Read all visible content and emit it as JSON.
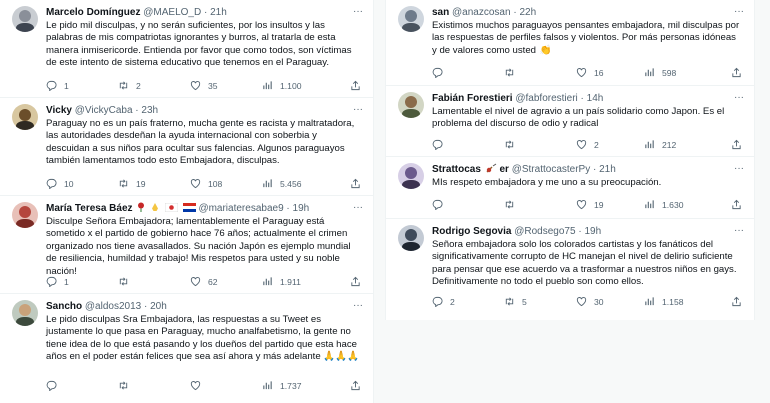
{
  "left_column": [
    {
      "name": "Marcelo Domínguez",
      "handle": "@MAELO_D",
      "time": "21h",
      "text": "Le pido mil disculpas, y no serán suficientes, por los insultos y las palabras de mis compatriotas ignorantes y burros, al tratarla de esta manera inmisericorde. Entienda por favor que como todos, son víctimas de este intento de sistema educativo que tenemos en el Paraguay.",
      "replies": "1",
      "retweets": "2",
      "likes": "35",
      "views": "1.100",
      "avatar_color": "#8a8f99"
    },
    {
      "name": "Vicky",
      "handle": "@VickyCaba",
      "time": "23h",
      "text": "Paraguay no es un país fraterno, mucha gente es racista y maltratadora, las autoridades desdeñan la ayuda internacional con soberbia y descuidan a sus niños para ocultar sus falencias.  Algunos paraguayos también lamentamos todo esto Embajadora, disculpas.",
      "replies": "10",
      "retweets": "19",
      "likes": "108",
      "views": "5.456",
      "avatar_color": "#5b4a2e"
    },
    {
      "name": "María Teresa Báez",
      "handle": "@mariateresabae9",
      "time": "19h",
      "text": "Disculpe Señora Embajadora; lamentablemente el Paraguay está sometido x el partido de gobierno hace 76 años; actualmente el crimen organizado nos tiene avasallados. Su nación Japón es ejemplo mundial de resiliencia, humildad y trabajo! Mis respetos para usted y su noble nación!",
      "replies": "1",
      "retweets": "",
      "likes": "62",
      "views": "1.911",
      "avatar_color": "#b5463d"
    },
    {
      "name": "Sancho",
      "handle": "@aldos2013",
      "time": "20h",
      "text": "Le pido disculpas Sra Embajadora, las respuestas a su Tweet es justamente lo que pasa en Paraguay, mucho analfabetismo, la gente no tiene idea de lo que está pasando y los dueños del partido que esta hace años en el poder están felices que sea así ahora y más adelante",
      "replies": "",
      "retweets": "",
      "likes": "",
      "views": "1.737",
      "avatar_color": "#7a8c7a"
    }
  ],
  "right_column": [
    {
      "name": "san",
      "handle": "@anazcosan",
      "time": "22h",
      "text": "Existimos muchos paraguayos pensantes embajadora, mil disculpas por las respuestas de perfiles falsos y violentos. Por más personas idóneas y de valores como usted",
      "replies": "",
      "retweets": "",
      "likes": "16",
      "views": "598",
      "avatar_color": "#6e7b8b"
    },
    {
      "name": "Fabián Forestieri",
      "handle": "@fabforestieri",
      "time": "14h",
      "text": "Lamentable el nivel de agravio a un país solidario como Japon. Es el problema del discurso de odio y radical",
      "replies": "",
      "retweets": "",
      "likes": "2",
      "views": "212",
      "avatar_color": "#4d5a3c"
    },
    {
      "name": "Strattocas",
      "name_suffix": "er",
      "handle": "@StrattocasterPy",
      "time": "21h",
      "text": "MIs respeto embajadora y me uno a su preocupación.",
      "replies": "",
      "retweets": "",
      "likes": "19",
      "views": "1.630",
      "avatar_color": "#6b5a8c"
    },
    {
      "name": "Rodrigo Segovia",
      "handle": "@Rodsego75",
      "time": "19h",
      "text": "Señora embajadora solo los colorados cartistas y los fanáticos del significativamente corrupto de HC manejan el nivel de delirio suficiente para pensar que ese acuerdo va a trasformar a nuestros niños en gays. Definitivamente no todo el pueblo son como ellos.",
      "replies": "2",
      "retweets": "5",
      "likes": "30",
      "views": "1.158",
      "avatar_color": "#3e4a5a"
    }
  ],
  "more_label": "···",
  "dot": "·",
  "emoji_praying": "🙏🙏🙏",
  "emoji_clap": "👏"
}
